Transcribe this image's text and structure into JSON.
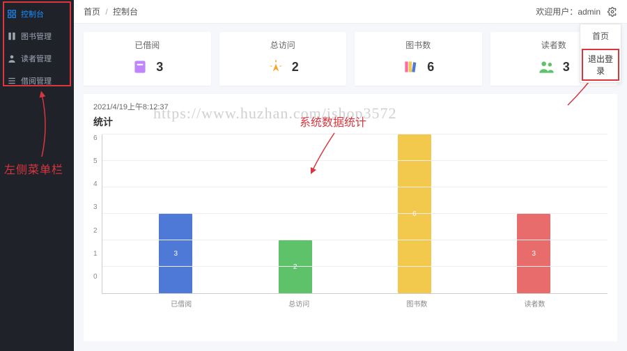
{
  "sidebar": {
    "items": [
      {
        "label": "控制台",
        "icon": "dashboard"
      },
      {
        "label": "图书管理",
        "icon": "book"
      },
      {
        "label": "读者管理",
        "icon": "user"
      },
      {
        "label": "借阅管理",
        "icon": "list"
      }
    ],
    "annotation": "左侧菜单栏"
  },
  "breadcrumb": {
    "home": "首页",
    "current": "控制台"
  },
  "user": {
    "welcome_prefix": "欢迎用户：",
    "name": "admin"
  },
  "dropdown": {
    "home": "首页",
    "logout": "退出登录"
  },
  "stats": [
    {
      "title": "已借阅",
      "value": "3",
      "icon": "borrow",
      "color": "#c084fc"
    },
    {
      "title": "总访问",
      "value": "2",
      "icon": "click",
      "color": "#f5a623"
    },
    {
      "title": "图书数",
      "value": "6",
      "icon": "books",
      "color": "#ff6b9d"
    },
    {
      "title": "读者数",
      "value": "3",
      "icon": "people",
      "color": "#5ec26a"
    }
  ],
  "panel": {
    "timestamp": "2021/4/19上午8:12:37",
    "title": "统计"
  },
  "center_annotation": "系统数据统计",
  "watermark": "https://www.huzhan.com/ishop3572",
  "chart_data": {
    "type": "bar",
    "title": "统计",
    "xlabel": "",
    "ylabel": "",
    "ylim": [
      0,
      6
    ],
    "yticks": [
      0,
      1,
      2,
      3,
      4,
      5,
      6
    ],
    "categories": [
      "已借阅",
      "总访问",
      "图书数",
      "读者数"
    ],
    "values": [
      3,
      2,
      6,
      3
    ],
    "colors": [
      "#4e79d6",
      "#5ec26a",
      "#f2c94c",
      "#e86c6c"
    ]
  }
}
